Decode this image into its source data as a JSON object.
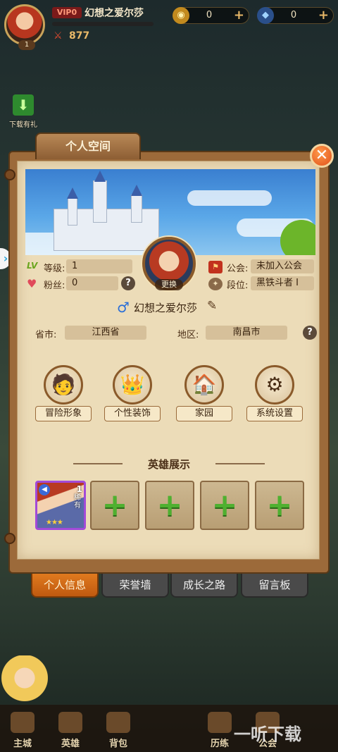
{
  "hud": {
    "vip_label": "VIP0",
    "player_name": "幻想之爱尔莎",
    "avatar_level": "1",
    "power": "877",
    "gold": "0",
    "diamond": "0",
    "gold_icon": "coin-icon",
    "diamond_icon": "diamond-icon"
  },
  "side": {
    "download_gift_label": "下载有礼"
  },
  "panel": {
    "tab_title": "个人空间",
    "change_avatar_label": "更换",
    "level_label": "等级:",
    "level_value": "1",
    "fans_label": "粉丝:",
    "fans_value": "0",
    "guild_label": "公会:",
    "guild_value": "未加入公会",
    "rank_label": "段位:",
    "rank_value": "黑铁斗者 I",
    "profile_name": "幻想之爱尔莎",
    "gender": "male",
    "province_label": "省市:",
    "province_value": "江西省",
    "region_label": "地区:",
    "region_value": "南昌市"
  },
  "functions": [
    {
      "label": "冒险形象",
      "icon": "hero-portrait-icon"
    },
    {
      "label": "个性装饰",
      "icon": "crown-icon"
    },
    {
      "label": "家园",
      "icon": "house-icon"
    },
    {
      "label": "系统设置",
      "icon": "gears-icon"
    }
  ],
  "showcase": {
    "title": "英雄展示",
    "hero": {
      "level": "1",
      "rarity": "稀有",
      "stars": "★★★"
    }
  },
  "tabs": [
    "个人信息",
    "荣誉墙",
    "成长之路",
    "留言板"
  ],
  "active_tab": "个人信息",
  "nav": [
    "主城",
    "英雄",
    "背包",
    "历练",
    "公会"
  ],
  "watermark": "一听下载",
  "colors": {
    "accent_orange": "#e07a1e",
    "paper": "#ecdcb8",
    "plus_green": "#4fb030"
  }
}
